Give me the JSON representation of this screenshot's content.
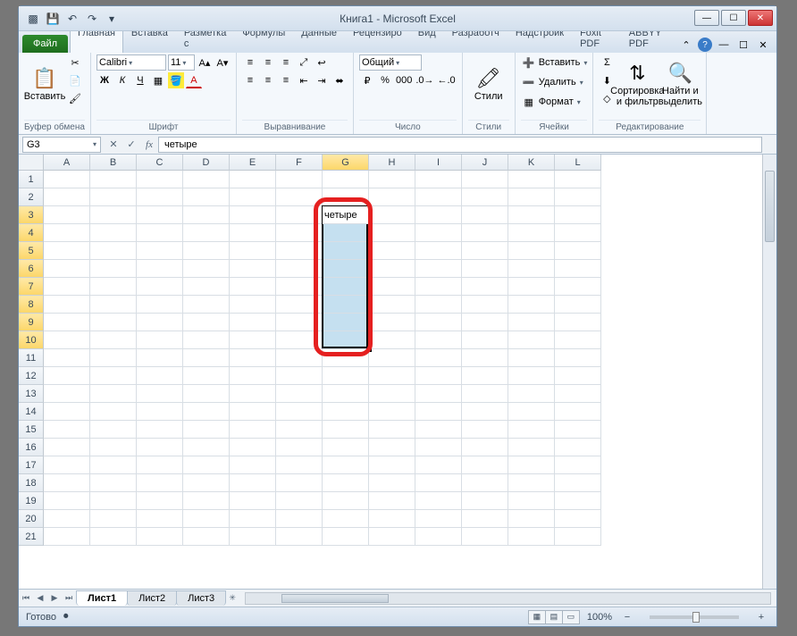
{
  "window": {
    "title": "Книга1 - Microsoft Excel"
  },
  "qat": {
    "save": "💾",
    "undo": "↶",
    "redo": "↷",
    "more": "▾"
  },
  "winctrl": {
    "min": "—",
    "max": "☐",
    "close": "✕"
  },
  "tabs": {
    "file": "Файл",
    "items": [
      "Главная",
      "Вставка",
      "Разметка с",
      "Формулы",
      "Данные",
      "Рецензиро",
      "Вид",
      "Разработч",
      "Надстройк",
      "Foxit PDF",
      "ABBYY PDF"
    ],
    "active_index": 0
  },
  "ribbon": {
    "clipboard": {
      "paste": "Вставить",
      "label": "Буфер обмена",
      "cut": "✂",
      "copy": "📄",
      "brush": "🖌"
    },
    "font": {
      "label": "Шрифт",
      "name": "Calibri",
      "size": "11",
      "bold": "Ж",
      "italic": "К",
      "underline": "Ч",
      "border": "▦",
      "fill": "🪣",
      "color": "A"
    },
    "align": {
      "label": "Выравнивание"
    },
    "number": {
      "label": "Число",
      "format": "Общий",
      "percent": "%",
      "comma": "000"
    },
    "styles": {
      "label": "Стили",
      "btn": "Стили"
    },
    "cells": {
      "label": "Ячейки",
      "insert": "Вставить",
      "delete": "Удалить",
      "format": "Формат"
    },
    "editing": {
      "label": "Редактирование",
      "sort": "Сортировка\nи фильтр",
      "find": "Найти и\nвыделить",
      "sigma": "Σ",
      "fill": "⬇",
      "clear": "◇"
    }
  },
  "formula": {
    "cell_ref": "G3",
    "fx": "fx",
    "value": "четыре"
  },
  "grid": {
    "columns": [
      "A",
      "B",
      "C",
      "D",
      "E",
      "F",
      "G",
      "H",
      "I",
      "J",
      "K",
      "L"
    ],
    "rows": 21,
    "selected_col_index": 6,
    "selected_rows": [
      3,
      4,
      5,
      6,
      7,
      8,
      9,
      10
    ],
    "active_cell": {
      "col": 6,
      "row": 3,
      "value": "четыре"
    }
  },
  "sheets": {
    "items": [
      "Лист1",
      "Лист2",
      "Лист3"
    ],
    "active": 0
  },
  "status": {
    "ready": "Готово",
    "zoom": "100%",
    "minus": "−",
    "plus": "+"
  }
}
